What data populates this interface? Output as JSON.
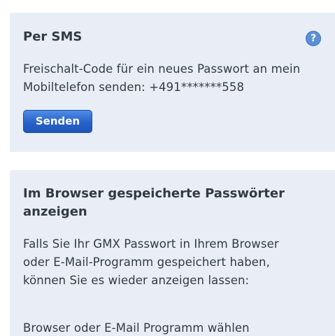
{
  "sms_section": {
    "title": "Per SMS",
    "help_icon_glyph": "?",
    "description_line1": "Freischalt-Code für ein neues Passwort an mein",
    "description_line2": "Mobiltelefon senden: +491*******558",
    "send_button_label": "Senden"
  },
  "browser_section": {
    "title_line1": "Im Browser gespeicherte Passwörter",
    "title_line2": "anzeigen",
    "intro_line1": "Falls Sie Ihr GMX Passwort in Ihrem Browser",
    "intro_line2": "oder E-Mail-Programm gespeichert haben,",
    "intro_line3": "können Sie es wieder anzeigen lassen:",
    "choose_program": "Browser oder E-Mail Programm wählen"
  },
  "colors": {
    "card_background": "#e9eef6",
    "button_blue": "#2862c9",
    "help_icon_blue": "#5b8fd6",
    "text": "#333a44"
  },
  "icons": {
    "help": "help-icon"
  }
}
